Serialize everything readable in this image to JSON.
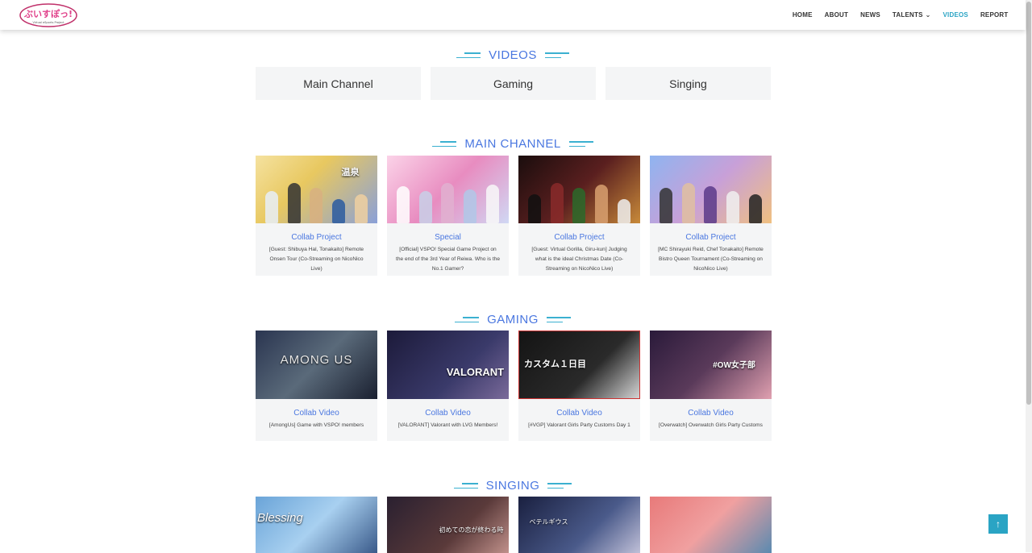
{
  "brand": {
    "logo_text": "ぶいすぽっ!",
    "logo_sub": "Virtual eSports Project"
  },
  "nav": [
    {
      "label": "HOME"
    },
    {
      "label": "ABOUT"
    },
    {
      "label": "NEWS"
    },
    {
      "label": "TALENTS"
    },
    {
      "label": "VIDEOS"
    },
    {
      "label": "REPORT"
    }
  ],
  "colors": {
    "accent": "#4a77e0",
    "nav_active": "#2aa4c4",
    "card_bg": "#f4f5f6"
  },
  "videos": {
    "title": "VIDEOS",
    "categories": [
      "Main Channel",
      "Gaming",
      "Singing"
    ]
  },
  "main_channel": {
    "title": "MAIN CHANNEL",
    "cards": [
      {
        "tag": "Collab Project",
        "desc": "[Guest: Shibuya Hal, Tonakaito] Remote Onsen Tour (Co-Streaming on NicoNico Live)",
        "thumb_text": "温泉"
      },
      {
        "tag": "Special",
        "desc": "[Official] VSPO! Special Game Project on the end of the 3rd Year of Reiwa. Who is the No.1 Gamer?",
        "thumb_text": ""
      },
      {
        "tag": "Collab Project",
        "desc": "[Guest: Virtual Gorilla, Giru-kun] Judging what is the ideal Christmas Date (Co-Streaming on NicoNico Live)",
        "thumb_text": ""
      },
      {
        "tag": "Collab Project",
        "desc": "[MC Shirayuki Reid, Chef Tonakaito] Remote Bistro Queen Tournament (Co-Streaming on NicoNico Live)",
        "thumb_text": ""
      }
    ]
  },
  "gaming": {
    "title": "GAMING",
    "cards": [
      {
        "tag": "Collab Video",
        "desc": "[AmongUs] Game with VSPO! members",
        "thumb_text": "AMONG US"
      },
      {
        "tag": "Collab Video",
        "desc": "[VALORANT] Valorant with LVG Members!",
        "thumb_text": "VALORANT"
      },
      {
        "tag": "Collab Video",
        "desc": "[#VGP] Valorant Girls Party Customs Day 1",
        "thumb_text": "カスタム１日目"
      },
      {
        "tag": "Collab Video",
        "desc": "[Overwatch] Overwatch Girls Party Customs",
        "thumb_text": "#OW女子部"
      }
    ]
  },
  "singing": {
    "title": "SINGING",
    "cards": [
      {
        "thumb_text": "Blessing"
      },
      {
        "thumb_text": "初めての恋が終わる時"
      },
      {
        "thumb_text": "ベテルギウス"
      },
      {
        "thumb_text": ""
      }
    ]
  },
  "back_to_top": "↑"
}
